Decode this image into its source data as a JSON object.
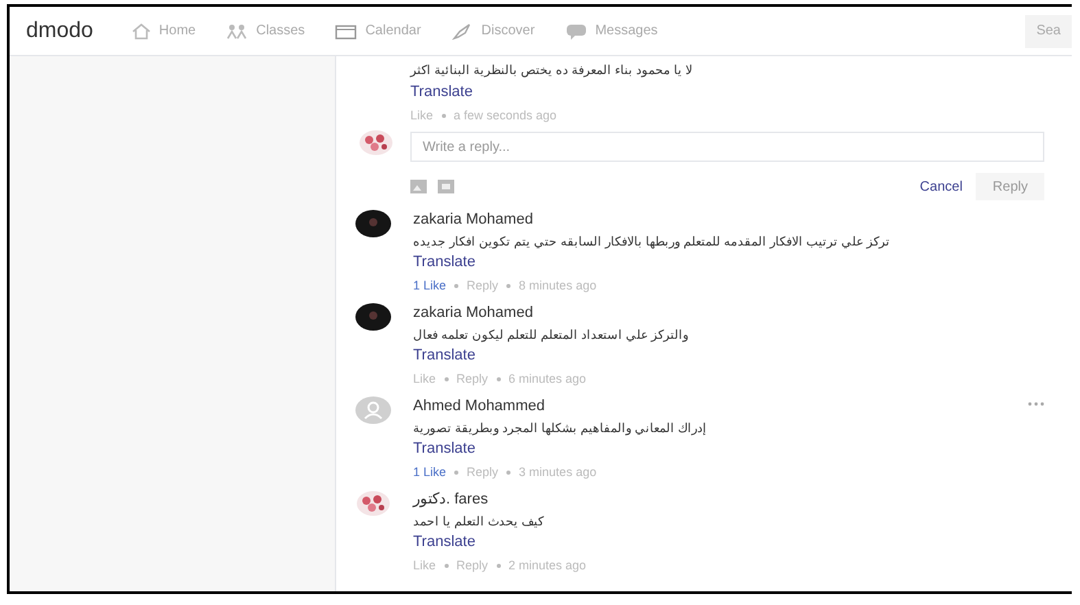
{
  "nav": {
    "logo": "dmodo",
    "items": [
      {
        "label": "Home"
      },
      {
        "label": "Classes"
      },
      {
        "label": "Calendar"
      },
      {
        "label": "Discover"
      },
      {
        "label": "Messages"
      }
    ],
    "search": "Sea"
  },
  "reply_thread": {
    "text": "لا يا محمود بناء المعرفة ده يختص بالنظرية البنائية اكثر",
    "translate": "Translate",
    "like": "Like",
    "liked": false,
    "time": "a few seconds ago",
    "reply_box": {
      "placeholder": "Write a reply..."
    },
    "cancel": "Cancel",
    "reply_button": {
      "label": "Reply",
      "disabled": true
    }
  },
  "comments": [
    {
      "author": "zakaria Mohamed",
      "text": "تركز علي ترتيب الافكار المقدمه للمتعلم وربطها بالافكار السابقه حتي يتم تكوين افكار جديده",
      "translate": "Translate",
      "like": "1 Like",
      "liked": true,
      "reply": "Reply",
      "time": "8 minutes ago",
      "menu": false
    },
    {
      "author": "zakaria Mohamed",
      "text": "والتركز علي استعداد المتعلم للتعلم ليكون تعلمه فعال",
      "translate": "Translate",
      "like": "Like",
      "liked": false,
      "reply": "Reply",
      "time": "6 minutes ago",
      "menu": false
    },
    {
      "author": "Ahmed Mohammed",
      "text": "إدراك المعاني والمفاهيم بشكلها المجرد وبطريقة تصورية",
      "translate": "Translate",
      "like": "1 Like",
      "liked": true,
      "reply": "Reply",
      "time": "3 minutes ago",
      "menu": true
    },
    {
      "author": "دكتور. fares",
      "text": "كيف يحدث التعلم يا احمد",
      "translate": "Translate",
      "like": "Like",
      "liked": false,
      "reply": "Reply",
      "time": "2 minutes ago",
      "menu": false
    }
  ]
}
